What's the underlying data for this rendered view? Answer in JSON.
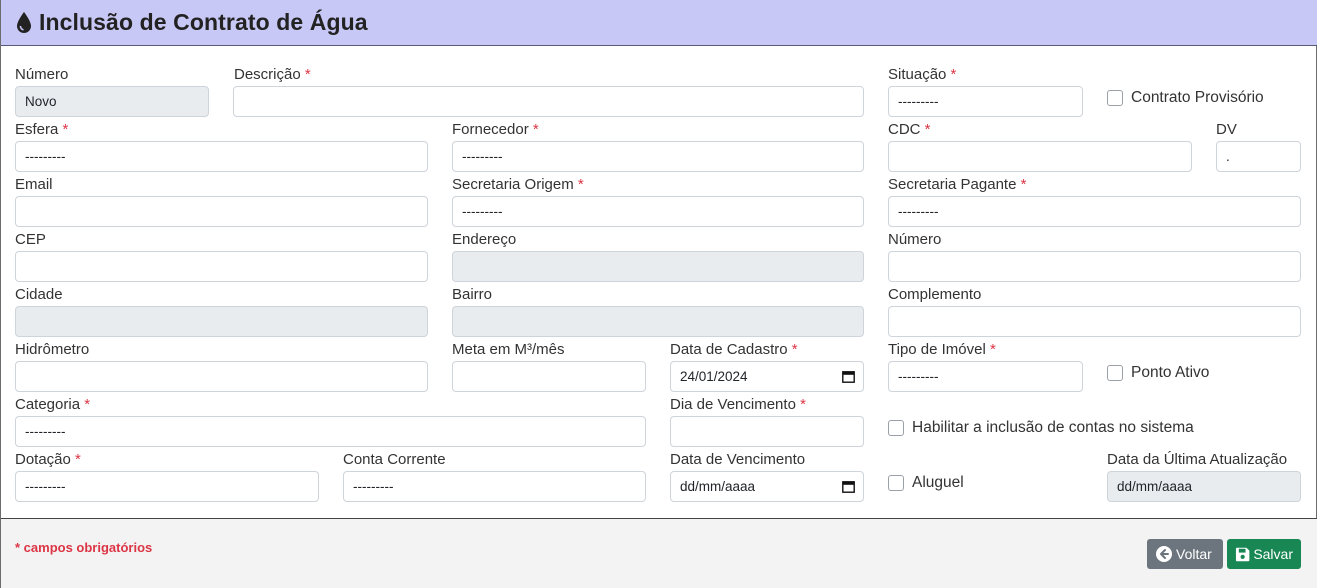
{
  "header": {
    "title": "Inclusão de Contrato de Água",
    "icon": "water-drop-icon",
    "bg": "#c8c8f6"
  },
  "required_mark": "*",
  "form": {
    "numero": {
      "label": "Número",
      "value": "Novo"
    },
    "descricao": {
      "label": "Descrição",
      "value": ""
    },
    "situacao": {
      "label": "Situação",
      "value": "---------"
    },
    "contrato_provisorio": {
      "label": "Contrato Provisório",
      "checked": false
    },
    "esfera": {
      "label": "Esfera",
      "value": "---------"
    },
    "fornecedor": {
      "label": "Fornecedor",
      "value": "---------"
    },
    "cdc": {
      "label": "CDC",
      "value": ""
    },
    "dv": {
      "label": "DV",
      "value": "."
    },
    "email": {
      "label": "Email",
      "value": ""
    },
    "secretaria_origem": {
      "label": "Secretaria Origem",
      "value": "---------"
    },
    "secretaria_pagante": {
      "label": "Secretaria Pagante",
      "value": "---------"
    },
    "cep": {
      "label": "CEP",
      "value": ""
    },
    "endereco": {
      "label": "Endereço",
      "value": ""
    },
    "numero_endereco": {
      "label": "Número",
      "value": ""
    },
    "cidade": {
      "label": "Cidade",
      "value": ""
    },
    "bairro": {
      "label": "Bairro",
      "value": ""
    },
    "complemento": {
      "label": "Complemento",
      "value": ""
    },
    "hidrometro": {
      "label": "Hidrômetro",
      "value": ""
    },
    "meta": {
      "label": "Meta em M³/mês",
      "value": ""
    },
    "data_cadastro": {
      "label": "Data de Cadastro",
      "value": "24/01/2024"
    },
    "tipo_imovel": {
      "label": "Tipo de Imóvel",
      "value": "---------"
    },
    "ponto_ativo": {
      "label": "Ponto Ativo",
      "checked": false
    },
    "categoria": {
      "label": "Categoria",
      "value": "---------"
    },
    "dia_vencimento": {
      "label": "Dia de Vencimento",
      "value": ""
    },
    "habilitar_inclusao": {
      "label": "Habilitar a inclusão de contas no sistema",
      "checked": false
    },
    "dotacao": {
      "label": "Dotação",
      "value": "---------"
    },
    "conta_corrente": {
      "label": "Conta Corrente",
      "value": "---------"
    },
    "data_vencimento": {
      "label": "Data de Vencimento",
      "value": "dd/mm/aaaa"
    },
    "aluguel": {
      "label": "Aluguel",
      "checked": false
    },
    "data_ultima_atualizacao": {
      "label": "Data da Última Atualização",
      "value": "dd/mm/aaaa"
    }
  },
  "footer": {
    "note": "* campos obrigatórios",
    "voltar_label": "Voltar",
    "salvar_label": "Salvar",
    "voltar_color": "#6c757d",
    "salvar_color": "#198754"
  }
}
